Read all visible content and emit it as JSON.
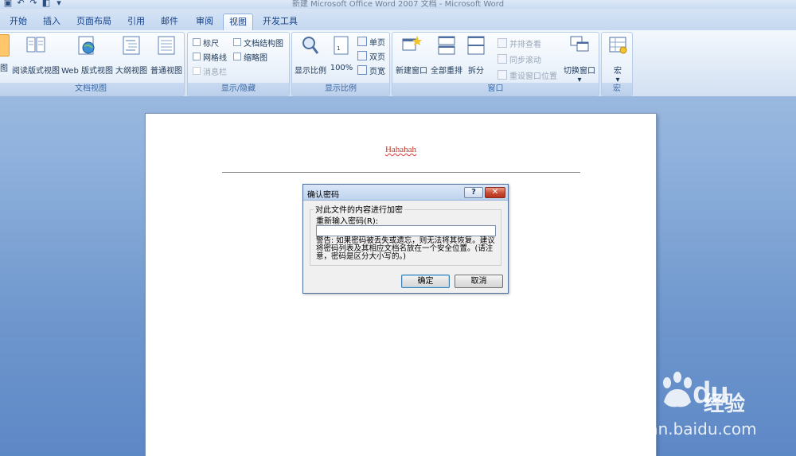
{
  "window": {
    "title": "新建 Microsoft Office Word 2007 文档 - Microsoft Word"
  },
  "quick_access": {
    "icons": [
      "save-icon",
      "undo-icon",
      "redo-icon",
      "print-preview-icon",
      "customize-arrow-icon"
    ]
  },
  "tabs": [
    {
      "label": "开始"
    },
    {
      "label": "插入"
    },
    {
      "label": "页面布局"
    },
    {
      "label": "引用"
    },
    {
      "label": "邮件"
    },
    {
      "label": "审阅"
    },
    {
      "label": "视图",
      "active": true
    },
    {
      "label": "开发工具"
    }
  ],
  "ribbon": {
    "doc_views": {
      "label": "文档视图",
      "buttons": [
        {
          "label": "图",
          "icon": "page-view-icon",
          "selected": true
        },
        {
          "label": "阅读版式视图",
          "icon": "reading-view-icon"
        },
        {
          "label": "Web 版式视图",
          "icon": "web-view-icon"
        },
        {
          "label": "大纲视图",
          "icon": "outline-view-icon"
        },
        {
          "label": "普通视图",
          "icon": "draft-view-icon"
        }
      ]
    },
    "show_hide": {
      "label": "显示/隐藏",
      "items": [
        {
          "label": "标尺",
          "checked": false
        },
        {
          "label": "文档结构图",
          "checked": false
        },
        {
          "label": "网格线",
          "checked": false
        },
        {
          "label": "缩略图",
          "checked": false
        },
        {
          "label": "消息栏",
          "checked": false,
          "disabled": true
        }
      ]
    },
    "zoom": {
      "label": "显示比例",
      "buttons": [
        {
          "label": "显示比例",
          "icon": "zoom-magnifier-icon"
        },
        {
          "label": "100%",
          "icon": "zoom-100-icon"
        }
      ],
      "small": [
        {
          "label": "单页",
          "icon": "one-page-icon"
        },
        {
          "label": "双页",
          "icon": "two-pages-icon"
        },
        {
          "label": "页宽",
          "icon": "page-width-icon"
        }
      ]
    },
    "window": {
      "label": "窗口",
      "buttons": [
        {
          "label": "新建窗口",
          "icon": "new-window-icon"
        },
        {
          "label": "全部重排",
          "icon": "arrange-all-icon"
        },
        {
          "label": "拆分",
          "icon": "split-icon"
        }
      ],
      "small": [
        {
          "label": "并排查看",
          "disabled": true
        },
        {
          "label": "同步滚动",
          "disabled": true
        },
        {
          "label": "重设窗口位置",
          "disabled": true
        }
      ],
      "switch": {
        "label": "切换窗口"
      }
    },
    "macros": {
      "label": "宏",
      "button": {
        "label": "宏"
      }
    }
  },
  "document": {
    "heading": "Hahahah"
  },
  "dialog": {
    "title": "确认密码",
    "help_label": "?",
    "close_label": "✕",
    "group_title": "对此文件的内容进行加密",
    "field_label": "重新输入密码(R):",
    "password_value": "",
    "warning": "警告: 如果密码被丢失或遗忘，则无法将其恢复。建议将密码列表及其相应文档名放在一个安全位置。(请注意，密码是区分大小写的。)",
    "ok_label": "确定",
    "cancel_label": "取消"
  },
  "watermark": {
    "logo": "Bai",
    "logo_tail": "du",
    "brand": "经验",
    "url": "jingyan.baidu.com"
  },
  "colors": {
    "accent": "#15428b",
    "selected_view": "#ffc66b",
    "close_button": "#c84b34",
    "desktop": "#6f97cd"
  }
}
